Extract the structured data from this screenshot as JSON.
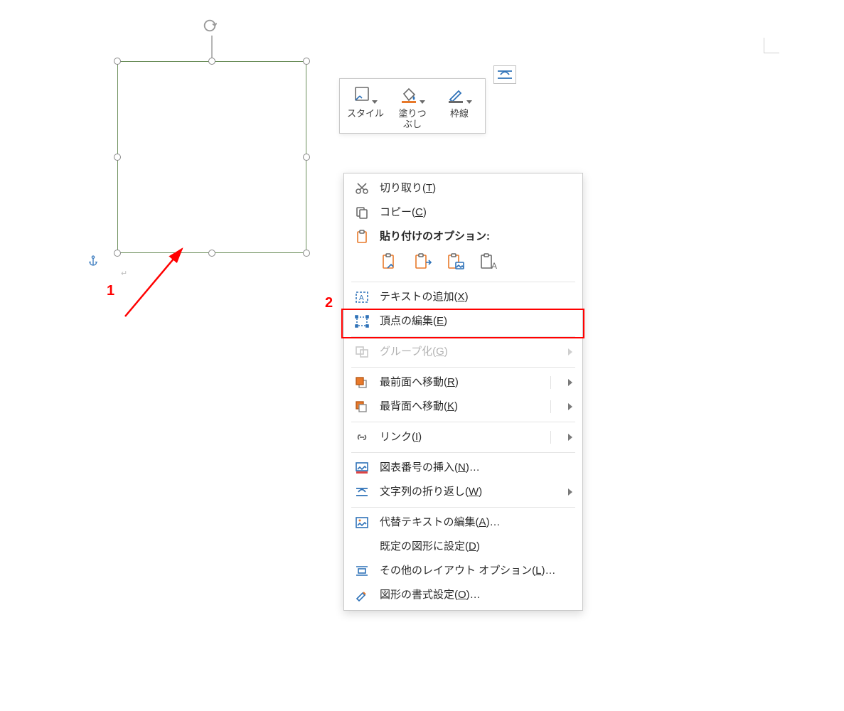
{
  "annotations": {
    "label1": "1",
    "label2": "2"
  },
  "mini_toolbar": {
    "style_label": "スタイル",
    "fill_label": "塗りつ\nぶし",
    "outline_label": "枠線"
  },
  "layout_options_button": "layout-options",
  "context_menu": {
    "cut": {
      "text": "切り取り(",
      "accel": "T",
      "suffix": ")"
    },
    "copy": {
      "text": "コピー(",
      "accel": "C",
      "suffix": ")"
    },
    "paste_header": {
      "text": "貼り付けのオプション:"
    },
    "paste_options": [
      "paste-keep-source",
      "paste-merge",
      "paste-picture",
      "paste-text-only"
    ],
    "add_text": {
      "text": "テキストの追加(",
      "accel": "X",
      "suffix": ")"
    },
    "edit_points": {
      "text": "頂点の編集(",
      "accel": "E",
      "suffix": ")"
    },
    "group": {
      "text": "グループ化(",
      "accel": "G",
      "suffix": ")"
    },
    "bring_front": {
      "text": "最前面へ移動(",
      "accel": "R",
      "suffix": ")"
    },
    "send_back": {
      "text": "最背面へ移動(",
      "accel": "K",
      "suffix": ")"
    },
    "link": {
      "text": "リンク(",
      "accel": "I",
      "suffix": ")"
    },
    "caption": {
      "text": "図表番号の挿入(",
      "accel": "N",
      "suffix": ")…"
    },
    "wrap_text": {
      "text": "文字列の折り返し(",
      "accel": "W",
      "suffix": ")"
    },
    "alt_text": {
      "text": "代替テキストの編集(",
      "accel": "A",
      "suffix": ")…"
    },
    "set_default": {
      "text": "既定の図形に設定(",
      "accel": "D",
      "suffix": ")"
    },
    "more_layout": {
      "text": "その他のレイアウト オプション(",
      "accel": "L",
      "suffix": ")…"
    },
    "format_shape": {
      "text": "図形の書式設定(",
      "accel": "O",
      "suffix": ")…"
    }
  },
  "colors": {
    "accent_orange": "#e8792a",
    "accent_blue": "#2f72b8",
    "shape_border": "#6b8e5a",
    "highlight_red": "#ff0000"
  }
}
